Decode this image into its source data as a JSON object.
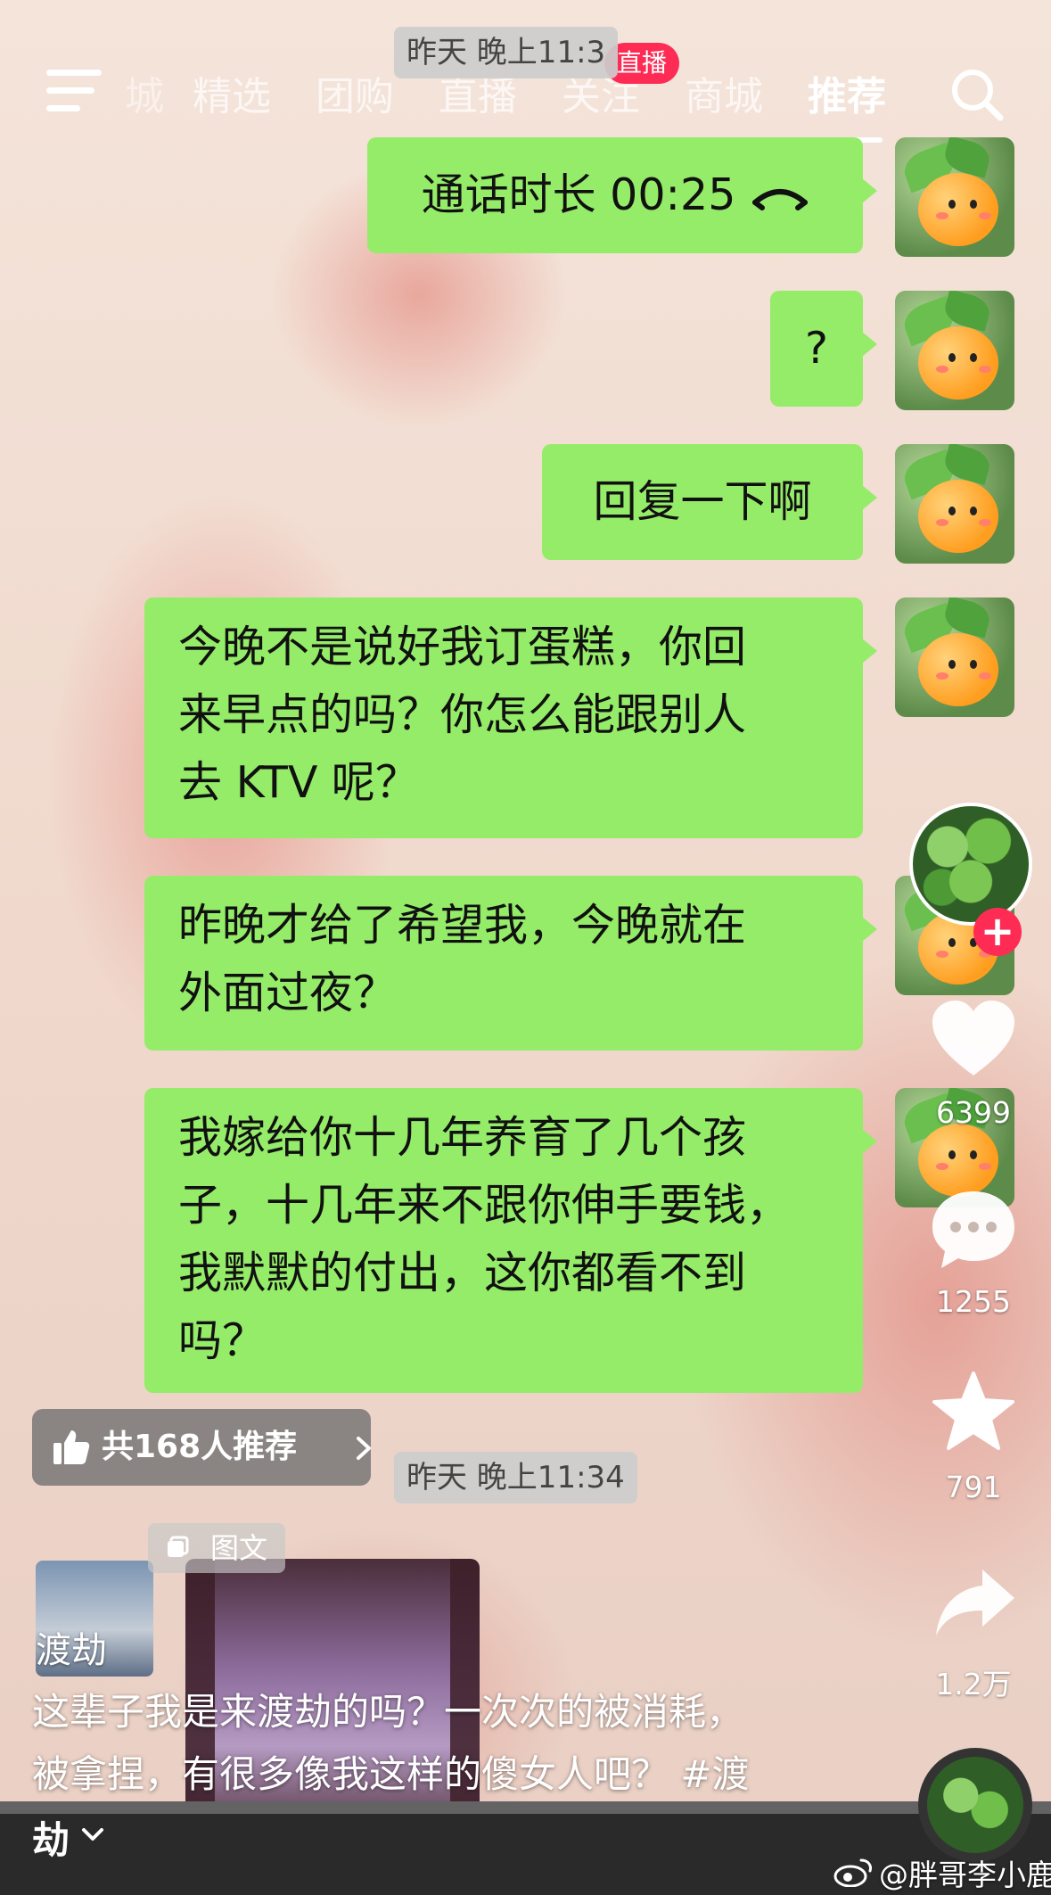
{
  "nav": {
    "partial_tab": "城",
    "tabs": [
      "精选",
      "团购",
      "直播",
      "关注",
      "商城",
      "推荐"
    ],
    "active_tab": "推荐",
    "live_badge": "直播",
    "time_chip_top": "昨天 晚上11:3"
  },
  "chat": {
    "call_label": "通话时长 00:25",
    "messages": [
      "?",
      "回复一下啊",
      "今晚不是说好我订蛋糕，你回来早点的吗？你怎么能跟别人去 KTV 呢？",
      "昨晚才给了希望我，今晚就在外面过夜？",
      "我嫁给你十几年养育了几个孩子，十几年来不跟你伸手要钱，我默默的付出，这你都看不到吗？"
    ],
    "message_lines": [
      [
        "?"
      ],
      [
        "回复一下啊"
      ],
      [
        "今晚不是说好我订蛋糕，你回",
        "来早点的吗？你怎么能跟别人",
        "去 KTV 呢？"
      ],
      [
        "昨晚才给了希望我，今晚就在",
        "外面过夜？"
      ],
      [
        "我嫁给你十几年养育了几个孩",
        "子，十几年来不跟你伸手要钱，",
        "我默默的付出，这你都看不到",
        "吗？"
      ]
    ],
    "time_chip_bottom": "昨天 晚上11:34"
  },
  "actions": {
    "likes": "6399",
    "comments": "1255",
    "favorites": "791",
    "shares": "1.2万",
    "follow": "+"
  },
  "post": {
    "recommend": "共168人推荐",
    "tag": "图文",
    "thumb_label": "渡劫",
    "caption_line1": "这辈子我是来渡劫的吗？一次次的被消耗，",
    "caption_line2": "被拿捏，有很多像我这样的傻女人吧？ #渡",
    "expand_label": "劫",
    "watermark": "@胖哥李小鹿"
  },
  "colors": {
    "bubble": "#95ec69",
    "accent": "#fe2c55"
  },
  "icons": [
    "menu-icon",
    "search-icon",
    "hangup-icon",
    "heart-icon",
    "comment-icon",
    "star-icon",
    "share-icon",
    "thumb-up-icon",
    "chevron-right-icon",
    "image-text-icon",
    "chevron-down-icon",
    "weibo-icon"
  ]
}
